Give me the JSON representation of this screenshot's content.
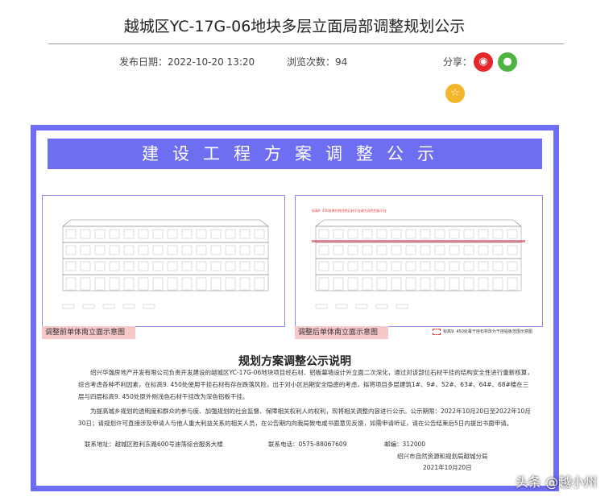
{
  "article": {
    "title": "越城区YC-17G-06地块多层立面局部调整规划公示",
    "publish_label": "发布日期：2022-10-20 13:20",
    "views_label": "浏览次数：94",
    "share_label": "分享："
  },
  "share_icons": [
    "weibo-icon",
    "wechat-icon",
    "favorite-star-icon"
  ],
  "poster": {
    "banner": "建设工程方案调整公示",
    "before_caption": "调整前单体南立面示意图",
    "after_caption": "调整后单体南立面示意图",
    "after_annotation": "标高9. 450处原外侧浅色石材干挂改为深色铝板干挂",
    "legend_note": "标高9. 450处幕干挂石材改为干挂铝板范围示意图",
    "section_title": "规划方案调整公示说明",
    "para1": "绍兴华瀚房地产开发有限公司负责开发建设的越城区YC-17G-06地块项目经石材、铝板幕墙设计外立面二次深化，通过对该部位石材干挂的结构安全性进行重新核算，综合考虑各种不利因素，在标高9. 450处使用干挂石材有存在跌落风险，出于对小区后期安全隐患的考虑，拟将项目多层建筑1#、9#、52#、63#、64#、68#楼在三层与四层标高9. 450处原外侧浅色石材干挂改为深色铝板干挂。",
    "para2": "为提高城乡规划的透明度和群众的参与度、加强规划的社会监督、保障相关权利人的权利，现将相关调整内容进行公示。公示期限：2022年10月20日至2022年10月30日；请规划许可直接涉及申请人与他人重大利益关系的相关人员，在公告期内向我局致电或书面意见反馈，如需申请听证，请在公告结束后5日内提出书面申请。",
    "address": "联系地址：越城区胜利东路600号迪荡综合服务大楼",
    "phone": "联系电话：0575-88067609",
    "postcode": "邮编：312000",
    "issuer": "绍兴市自然资源和规划局越城分局",
    "date": "2021年10月20日"
  },
  "watermark": "头条 @越小州",
  "colors": {
    "border": "#6d6df7",
    "banner": "#6e6ef2",
    "caption": "#f6c9c9",
    "weibo": "#e6272c",
    "wechat": "#4fb342",
    "star": "#f3b52a"
  }
}
